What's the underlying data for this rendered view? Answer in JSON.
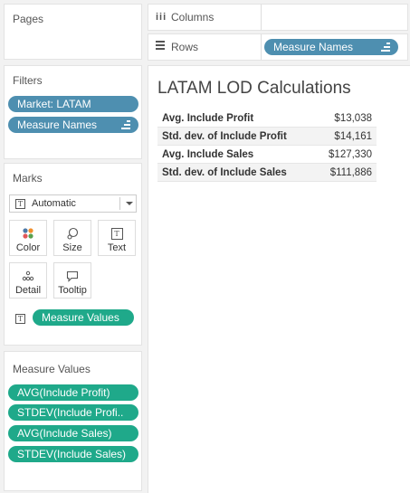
{
  "pages": {
    "title": "Pages"
  },
  "shelves": {
    "columns_label": "Columns",
    "rows_label": "Rows",
    "rows_pill": "Measure Names"
  },
  "filters": {
    "title": "Filters",
    "items": [
      "Market: LATAM",
      "Measure Names"
    ]
  },
  "marks": {
    "title": "Marks",
    "type_select": "Automatic",
    "buttons": {
      "color": "Color",
      "size": "Size",
      "text": "Text",
      "detail": "Detail",
      "tooltip": "Tooltip"
    },
    "text_pill": "Measure Values"
  },
  "measure_values": {
    "title": "Measure Values",
    "items": [
      "AVG(Include Profit)",
      "STDEV(Include Profi..",
      "AVG(Include Sales)",
      "STDEV(Include Sales)"
    ]
  },
  "view": {
    "title": "LATAM LOD Calculations",
    "rows": [
      {
        "label": "Avg. Include Profit",
        "value": "$13,038"
      },
      {
        "label": "Std. dev. of Include Profit",
        "value": "$14,161"
      },
      {
        "label": "Avg. Include Sales",
        "value": "$127,330"
      },
      {
        "label": "Std. dev. of Include Sales",
        "value": "$111,886"
      }
    ]
  },
  "colors": {
    "dimension_pill": "#4e8fb0",
    "measure_pill": "#1fa98a"
  }
}
